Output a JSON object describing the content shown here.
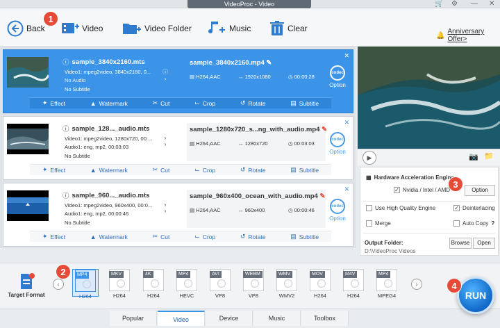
{
  "window": {
    "title": "VideoProc - Video"
  },
  "toolbar": {
    "back": "Back",
    "video": "Video",
    "video_folder": "Video Folder",
    "music": "Music",
    "clear": "Clear",
    "anniversary": "Anniversary Offer>"
  },
  "badges": [
    "1",
    "2",
    "3",
    "4"
  ],
  "edit_actions": [
    "Effect",
    "Watermark",
    "Cut",
    "Crop",
    "Rotate",
    "Subtitle"
  ],
  "files": [
    {
      "name": "sample_3840x2160.mts",
      "video": "Video1: mpeg2video, 3840x2160, 0...",
      "audio": "No Audio",
      "subtitle": "No Subtitle",
      "output": "sample_3840x2160.mp4",
      "codec": "H264,AAC",
      "resolution": "1920x1080",
      "duration": "00:00:28",
      "option": "Option"
    },
    {
      "name": "sample_128..._audio.mts",
      "video": "Video1: mpeg2video, 1280x720, 00:...",
      "audio": "Audio1: eng, mp2, 00:03:03",
      "subtitle": "No Subtitle",
      "output": "sample_1280x720_s...ng_with_audio.mp4",
      "codec": "H264,AAC",
      "resolution": "1280x720",
      "duration": "00:03:03",
      "option": "Option"
    },
    {
      "name": "sample_960..._audio.mts",
      "video": "Video1: mpeg2video, 960x400, 00:0...",
      "audio": "Audio1: eng, mp2, 00:00:46",
      "subtitle": "No Subtitle",
      "output": "sample_960x400_ocean_with_audio.mp4",
      "codec": "H264,AAC",
      "resolution": "960x400",
      "duration": "00:00:46",
      "option": "Option"
    }
  ],
  "settings": {
    "hw_title": "Hardware Acceleration Engine",
    "hw_vendor": "Nvidia / Intel / AMD",
    "option_btn": "Option",
    "high_quality": "Use High Quality Engine",
    "deinterlacing": "Deinterlacing",
    "merge": "Merge",
    "auto_copy": "Auto Copy",
    "auto_copy_help": "?",
    "output_folder_label": "Output Folder:",
    "output_folder_path": "D:\\VideoProc Videos",
    "browse": "Browse",
    "open": "Open",
    "hw_checked": true,
    "deinterlacing_checked": true
  },
  "target_format": {
    "label": "Target Format"
  },
  "formats": [
    {
      "container": "MP4",
      "codec": "H264",
      "selected": true
    },
    {
      "container": "MKV",
      "codec": "H264"
    },
    {
      "container": "4K",
      "codec": "H264"
    },
    {
      "container": "MP4",
      "codec": "HEVC"
    },
    {
      "container": "AVI",
      "codec": "VP8"
    },
    {
      "container": "WEBM",
      "codec": "VP8"
    },
    {
      "container": "WMV",
      "codec": "WMV2"
    },
    {
      "container": "MOV",
      "codec": "H264"
    },
    {
      "container": "M4V",
      "codec": "H264"
    },
    {
      "container": "MP4",
      "codec": "MPEG4"
    }
  ],
  "tabs": [
    "Popular",
    "Video",
    "Device",
    "Music",
    "Toolbox"
  ],
  "active_tab": "Video",
  "run": "RUN",
  "colors": {
    "accent": "#3b94e8",
    "badge": "#e54b37",
    "run": "#1068c8"
  }
}
